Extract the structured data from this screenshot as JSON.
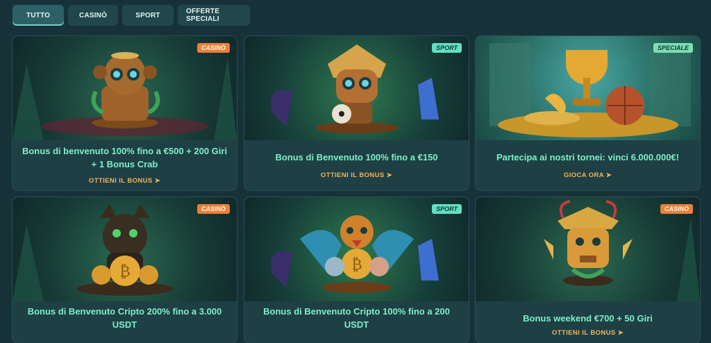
{
  "tabs": [
    {
      "label": "TUTTO",
      "active": true
    },
    {
      "label": "CASINÒ",
      "active": false
    },
    {
      "label": "SPORT",
      "active": false
    },
    {
      "label": "OFFERTE SPECIALI",
      "active": false
    }
  ],
  "cards": [
    {
      "badge": "CASINÒ",
      "title": "Bonus di benvenuto 100% fino a €500 + 200 Giri + 1 Bonus Crab",
      "cta": "OTTIENI IL BONUS ➤"
    },
    {
      "badge": "SPORT",
      "title": "Bonus di Benvenuto 100% fino a €150",
      "cta": "OTTIENI IL BONUS ➤"
    },
    {
      "badge": "SPECIALE",
      "title": "Partecipa ai nostri tornei: vinci 6.000.000€!",
      "cta": "GIOCA ORA ➤"
    },
    {
      "badge": "CASINÒ",
      "title": "Bonus di Benvenuto Cripto 200% fino a 3.000 USDT",
      "cta": ""
    },
    {
      "badge": "SPORT",
      "title": "Bonus di Benvenuto Cripto 100% fino a 200 USDT",
      "cta": ""
    },
    {
      "badge": "CASINÒ",
      "title": "Bonus weekend €700 + 50 Giri",
      "cta": "OTTIENI IL BONUS ➤"
    }
  ],
  "colors": {
    "background": "#163238",
    "card": "#1e3f44",
    "title": "#7df0c9",
    "cta": "#f0b45a",
    "badge_casino": "#e9803b",
    "badge_sport": "#62e0c4"
  }
}
